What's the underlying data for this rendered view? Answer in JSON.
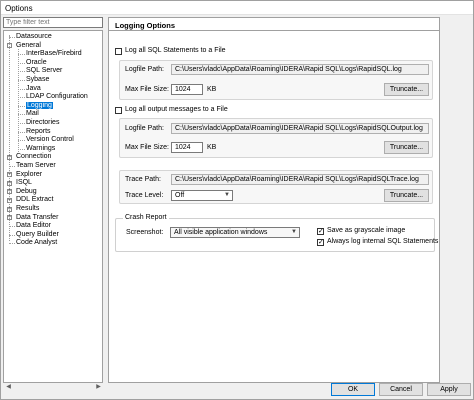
{
  "window": {
    "title": "Options"
  },
  "filter": {
    "placeholder": "Type filter text"
  },
  "tree": [
    {
      "label": "Datasource",
      "level": 1,
      "expander": ""
    },
    {
      "label": "General",
      "level": 0,
      "expander": "-"
    },
    {
      "label": "InterBase/Firebird",
      "level": 2,
      "expander": ""
    },
    {
      "label": "Oracle",
      "level": 2,
      "expander": ""
    },
    {
      "label": "SQL Server",
      "level": 2,
      "expander": ""
    },
    {
      "label": "Sybase",
      "level": 2,
      "expander": ""
    },
    {
      "label": "Java",
      "level": 2,
      "expander": ""
    },
    {
      "label": "LDAP Configuration",
      "level": 2,
      "expander": ""
    },
    {
      "label": "Logging",
      "level": 2,
      "expander": "",
      "selected": true
    },
    {
      "label": "Mail",
      "level": 2,
      "expander": ""
    },
    {
      "label": "Directories",
      "level": 2,
      "expander": ""
    },
    {
      "label": "Reports",
      "level": 2,
      "expander": ""
    },
    {
      "label": "Version Control",
      "level": 2,
      "expander": ""
    },
    {
      "label": "Warnings",
      "level": 2,
      "expander": ""
    },
    {
      "label": "Connection",
      "level": 0,
      "expander": "+"
    },
    {
      "label": "Team Server",
      "level": 1,
      "expander": ""
    },
    {
      "label": "Explorer",
      "level": 0,
      "expander": "+"
    },
    {
      "label": "ISQL",
      "level": 0,
      "expander": "+"
    },
    {
      "label": "Debug",
      "level": 0,
      "expander": "+"
    },
    {
      "label": "DDL Extract",
      "level": 0,
      "expander": "+"
    },
    {
      "label": "Results",
      "level": 0,
      "expander": "+"
    },
    {
      "label": "Data Transfer",
      "level": 0,
      "expander": "+"
    },
    {
      "label": "Data Editor",
      "level": 1,
      "expander": ""
    },
    {
      "label": "Query Builder",
      "level": 1,
      "expander": ""
    },
    {
      "label": "Code Analyst",
      "level": 1,
      "expander": ""
    }
  ],
  "panel": {
    "header": "Logging Options",
    "sql_log": {
      "checkbox_label": "Log all SQL Statements to a File",
      "path_label": "Logfile Path:",
      "path_value": "C:\\Users\\vladc\\AppData\\Roaming\\IDERA\\Rapid SQL\\Logs\\RapidSQL.log",
      "size_label": "Max File Size:",
      "size_value": "1024",
      "size_unit": "KB",
      "truncate_label": "Truncate..."
    },
    "output_log": {
      "checkbox_label": "Log all output messages to a File",
      "path_label": "Logfile Path:",
      "path_value": "C:\\Users\\vladc\\AppData\\Roaming\\IDERA\\Rapid SQL\\Logs\\RapidSQLOutput.log",
      "size_label": "Max File Size:",
      "size_value": "1024",
      "size_unit": "KB",
      "truncate_label": "Truncate..."
    },
    "trace": {
      "path_label": "Trace Path:",
      "path_value": "C:\\Users\\vladc\\AppData\\Roaming\\IDERA\\Rapid SQL\\Logs\\RapidSQLTrace.log",
      "level_label": "Trace Level:",
      "level_value": "Off",
      "truncate_label": "Truncate..."
    },
    "crash": {
      "legend": "Crash Report",
      "screenshot_label": "Screenshot:",
      "screenshot_value": "All visible application windows",
      "grayscale_label": "Save as grayscale image",
      "grayscale_checked": true,
      "always_log_label": "Always log internal SQL Statements",
      "always_log_checked": true
    }
  },
  "buttons": {
    "ok": "OK",
    "cancel": "Cancel",
    "apply": "Apply"
  },
  "colors": {
    "selection": "#0078d7",
    "accent_border": "#0078d7"
  }
}
